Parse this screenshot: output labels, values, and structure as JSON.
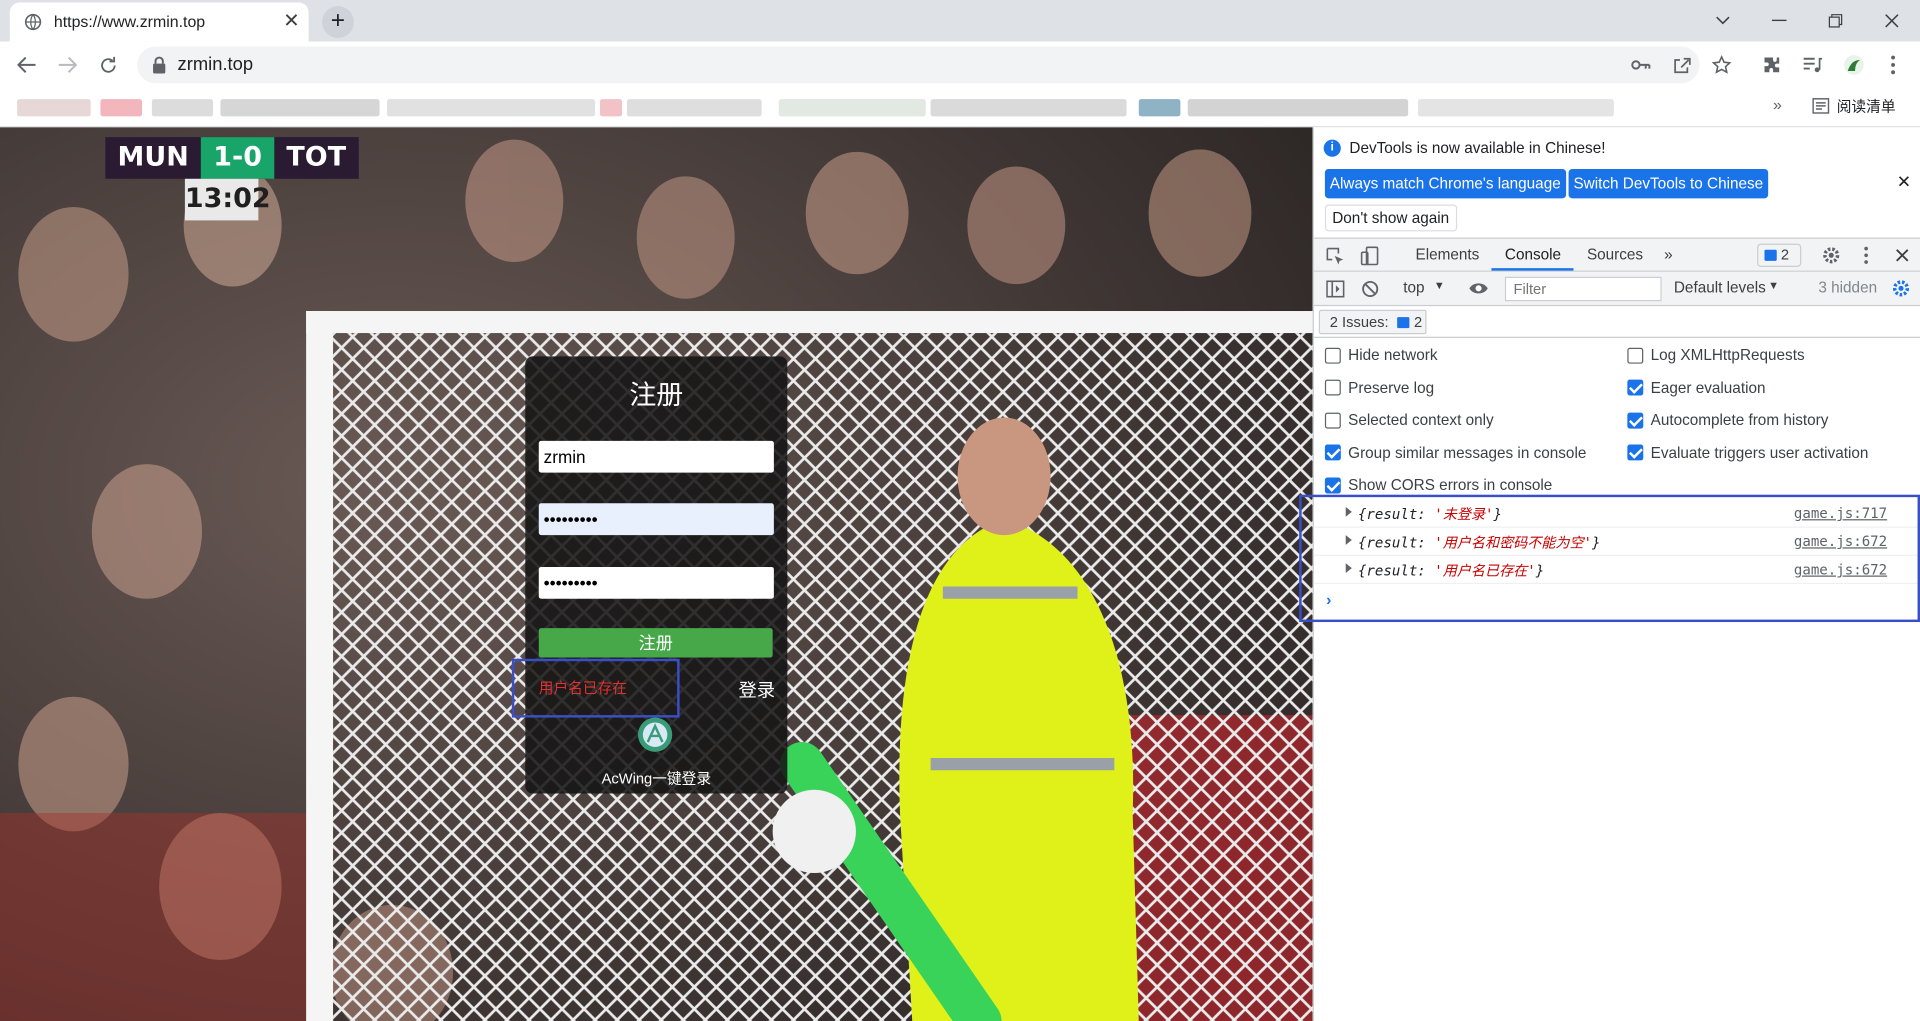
{
  "browser": {
    "tab_title": "https://www.zrmin.top",
    "tab_close": "✕",
    "new_tab": "+",
    "url": "zrmin.top",
    "bookmarks_more": "»",
    "reading_list": "阅读清单"
  },
  "scoreboard": {
    "home": "MUN",
    "score": "1-0",
    "away": "TOT",
    "clock": "13:02"
  },
  "register": {
    "title": "注册",
    "username_value": "zrmin",
    "password_value": "•••••••••",
    "confirm_value": "•••••••••",
    "submit_label": "注册",
    "error_message": "用户名已存在",
    "login_link": "登录",
    "acwing_label": "AcWing一键登录"
  },
  "devtools": {
    "info_text": "DevTools is now available in Chinese!",
    "btn_match": "Always match Chrome's language",
    "btn_switch": "Switch DevTools to Chinese",
    "btn_dont_show": "Don't show again",
    "tabs": [
      "Elements",
      "Console",
      "Sources"
    ],
    "tabs_more": "»",
    "issues_count": "2",
    "context": "top",
    "filter_placeholder": "Filter",
    "levels": "Default levels",
    "hidden": "3 hidden",
    "issues_label": "2 Issues:",
    "issues_chip_count": "2",
    "settings_left": [
      {
        "label": "Hide network",
        "checked": false
      },
      {
        "label": "Preserve log",
        "checked": false
      },
      {
        "label": "Selected context only",
        "checked": false
      },
      {
        "label": "Group similar messages in console",
        "checked": true
      },
      {
        "label": "Show CORS errors in console",
        "checked": true
      }
    ],
    "settings_right": [
      {
        "label": "Log XMLHttpRequests",
        "checked": false
      },
      {
        "label": "Eager evaluation",
        "checked": true
      },
      {
        "label": "Autocomplete from history",
        "checked": true
      },
      {
        "label": "Evaluate triggers user activation",
        "checked": true
      }
    ],
    "logs": [
      {
        "prefix": "{result: ",
        "value": "'未登录'",
        "suffix": "}",
        "source": "game.js:717"
      },
      {
        "prefix": "{result: ",
        "value": "'用户名和密码不能为空'",
        "suffix": "}",
        "source": "game.js:672"
      },
      {
        "prefix": "{result: ",
        "value": "'用户名已存在'",
        "suffix": "}",
        "source": "game.js:672"
      }
    ],
    "prompt": "›"
  },
  "colors": {
    "accent": "#1a73e8",
    "register_button": "#47a84a",
    "error_text": "#e23030",
    "highlight_box": "#3a4fc7"
  }
}
